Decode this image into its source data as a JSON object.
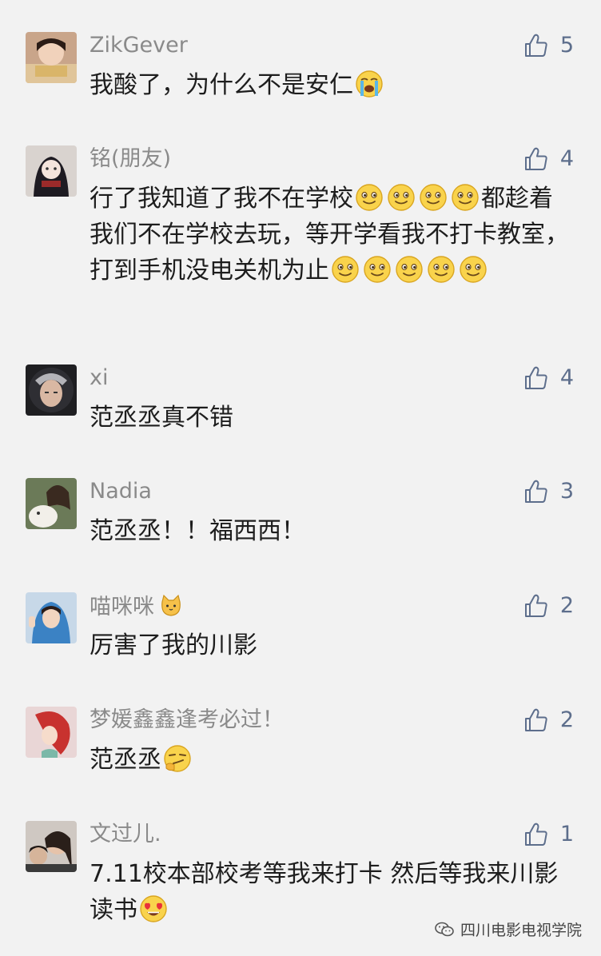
{
  "comments": [
    {
      "name": "ZikGever",
      "likes": "5",
      "avatar_icon": "child-reading-avatar",
      "parts": [
        "我酸了，为什么不是安仁",
        {
          "emoji": "crying"
        }
      ]
    },
    {
      "name": "铭(朋友)",
      "likes": "4",
      "avatar_icon": "anime-girl-avatar",
      "parts": [
        "行了我知道了我不在学校",
        {
          "emoji": "smile"
        },
        {
          "emoji": "smile"
        },
        {
          "emoji": "smile"
        },
        {
          "emoji": "smile"
        },
        "都趁着我们不在学校去玩，等开学看我不打卡教室，打到手机没电关机为止",
        {
          "emoji": "smile"
        },
        {
          "emoji": "smile"
        },
        {
          "emoji": "smile"
        },
        {
          "emoji": "smile"
        },
        {
          "emoji": "smile"
        }
      ]
    },
    {
      "name": "xi",
      "likes": "4",
      "avatar_icon": "helmet-portrait-avatar",
      "parts": [
        "范丞丞真不错"
      ]
    },
    {
      "name": "Nadia",
      "likes": "3",
      "avatar_icon": "girl-with-dog-avatar",
      "parts": [
        "范丞丞！！福西西！"
      ]
    },
    {
      "name": "喵咪咪",
      "name_emoji": "cat",
      "likes": "2",
      "avatar_icon": "girl-blue-hoodie-avatar",
      "parts": [
        "厉害了我的川影"
      ]
    },
    {
      "name": "梦媛鑫鑫逢考必过！",
      "likes": "2",
      "avatar_icon": "mermaid-avatar",
      "parts": [
        "范丞丞",
        {
          "emoji": "smirk"
        }
      ]
    },
    {
      "name": "文过儿.",
      "likes": "1",
      "avatar_icon": "couple-portrait-avatar",
      "parts": [
        "7.11校本部校考等我来打卡 然后等我来川影读书",
        {
          "emoji": "heart-eyes"
        }
      ]
    }
  ],
  "watermark": {
    "text": "四川电影电视学院",
    "icon": "wechat-icon"
  },
  "colors": {
    "background": "#f2f2f2",
    "name": "#8a8a8a",
    "text": "#1d1d1d",
    "like": "#5d6e8c"
  }
}
